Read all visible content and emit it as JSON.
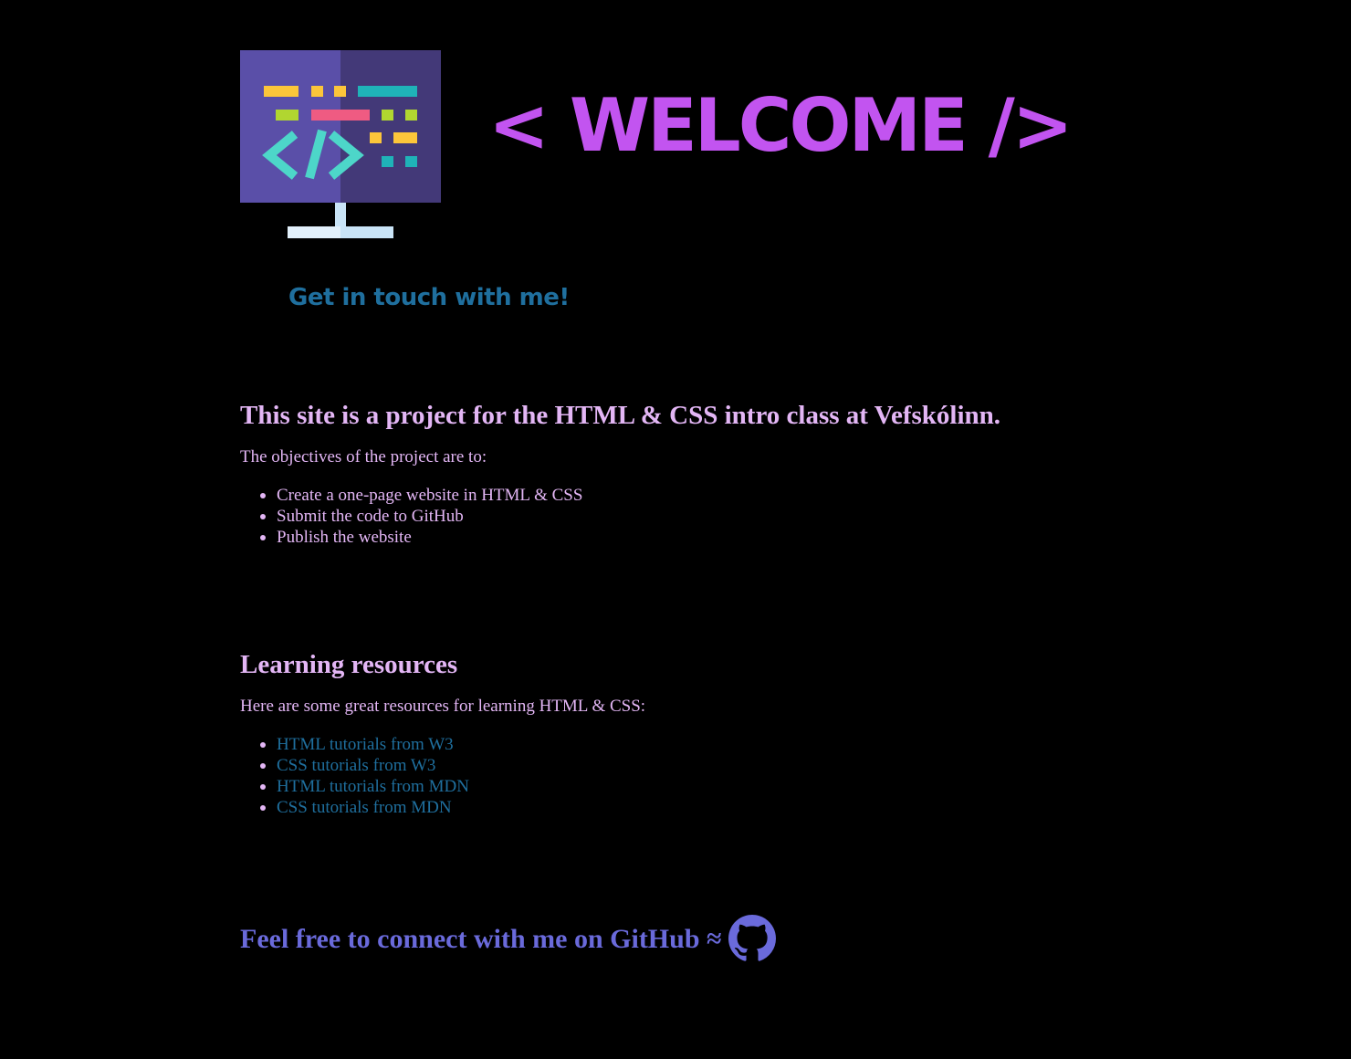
{
  "header": {
    "logo_icon": "code-monitor-icon",
    "title": "< WELCOME />",
    "contact_link": "Get in touch with me!"
  },
  "intro": {
    "heading": "This site is a project for the HTML & CSS intro class at Vefskólinn.",
    "lead": "The objectives of the project are to:",
    "objectives": [
      "Create a one-page website in HTML & CSS",
      "Submit the code to GitHub",
      "Publish the website"
    ]
  },
  "resources": {
    "heading": "Learning resources",
    "lead": "Here are some great resources for learning HTML & CSS:",
    "links": [
      "HTML tutorials from W3",
      "CSS tutorials from W3",
      "HTML tutorials from MDN",
      "CSS tutorials from MDN"
    ]
  },
  "footer": {
    "text": "Feel free to connect with me on GitHub ≈",
    "icon": "github-icon"
  },
  "colors": {
    "background": "#000000",
    "title": "#c254f0",
    "text": "#e3b6f5",
    "link": "#1f6f9e",
    "footer": "#6a6adb"
  }
}
